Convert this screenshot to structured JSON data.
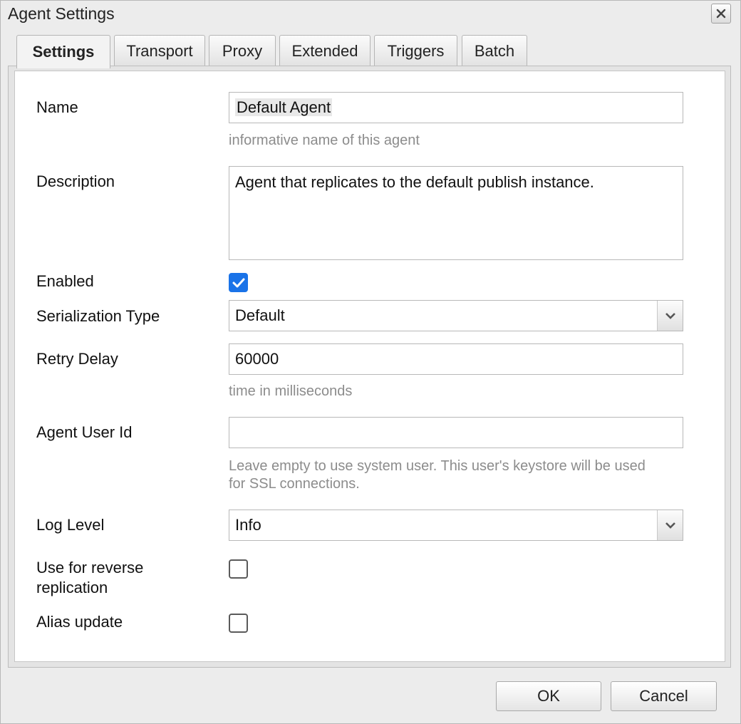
{
  "dialog": {
    "title": "Agent Settings",
    "close_icon": "close-icon"
  },
  "tabs": [
    {
      "label": "Settings",
      "active": true
    },
    {
      "label": "Transport",
      "active": false
    },
    {
      "label": "Proxy",
      "active": false
    },
    {
      "label": "Extended",
      "active": false
    },
    {
      "label": "Triggers",
      "active": false
    },
    {
      "label": "Batch",
      "active": false
    }
  ],
  "form": {
    "name": {
      "label": "Name",
      "value": "Default Agent",
      "hint": "informative name of this agent"
    },
    "description": {
      "label": "Description",
      "value": "Agent that replicates to the default publish instance."
    },
    "enabled": {
      "label": "Enabled",
      "checked": true
    },
    "serialization_type": {
      "label": "Serialization Type",
      "value": "Default"
    },
    "retry_delay": {
      "label": "Retry Delay",
      "value": "60000",
      "hint": "time in milliseconds"
    },
    "agent_user_id": {
      "label": "Agent User Id",
      "value": "",
      "hint_line1": "Leave empty to use system user. This user's keystore will be used",
      "hint_line2": "for SSL connections."
    },
    "log_level": {
      "label": "Log Level",
      "value": "Info"
    },
    "reverse_replication": {
      "label_line1": "Use for reverse",
      "label_line2": "replication",
      "checked": false
    },
    "alias_update": {
      "label": "Alias update",
      "checked": false
    }
  },
  "buttons": {
    "ok": "OK",
    "cancel": "Cancel"
  },
  "colors": {
    "checkbox_checked": "#1a73e8",
    "hint_text": "#8c8c8c"
  }
}
